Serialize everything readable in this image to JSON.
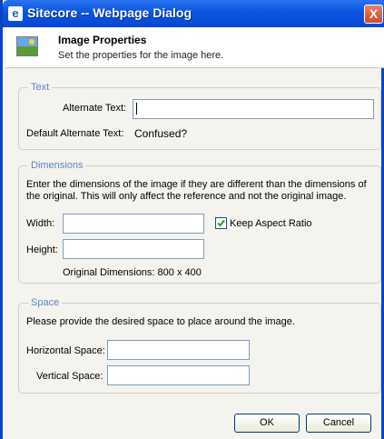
{
  "window": {
    "title": "Sitecore -- Webpage Dialog",
    "close_label": "X"
  },
  "header": {
    "title": "Image Properties",
    "subtitle": "Set the properties for the image here."
  },
  "text_group": {
    "legend": "Text",
    "alt_label": "Alternate Text:",
    "alt_value": "",
    "default_alt_label": "Default Alternate Text:",
    "default_alt_value": "Confused?"
  },
  "dimensions_group": {
    "legend": "Dimensions",
    "description_line1": "Enter the dimensions of the image if they are different than the dimensions of",
    "description_line2": "the original. This will only affect the reference and not the original image.",
    "width_label": "Width:",
    "width_value": "",
    "height_label": "Height:",
    "height_value": "",
    "keep_aspect_label": "Keep Aspect Ratio",
    "keep_aspect_checked": true,
    "original_dimensions": "Original Dimensions: 800 x 400"
  },
  "space_group": {
    "legend": "Space",
    "description": "Please provide the desired space to place around the image.",
    "hspace_label": "Horizontal Space:",
    "hspace_value": "",
    "vspace_label": "Vertical Space:",
    "vspace_value": ""
  },
  "buttons": {
    "ok": "OK",
    "cancel": "Cancel"
  },
  "colors": {
    "titlebar": "#0a55e0",
    "legend_text": "#5a85c8",
    "close_button": "#c94a2c"
  }
}
